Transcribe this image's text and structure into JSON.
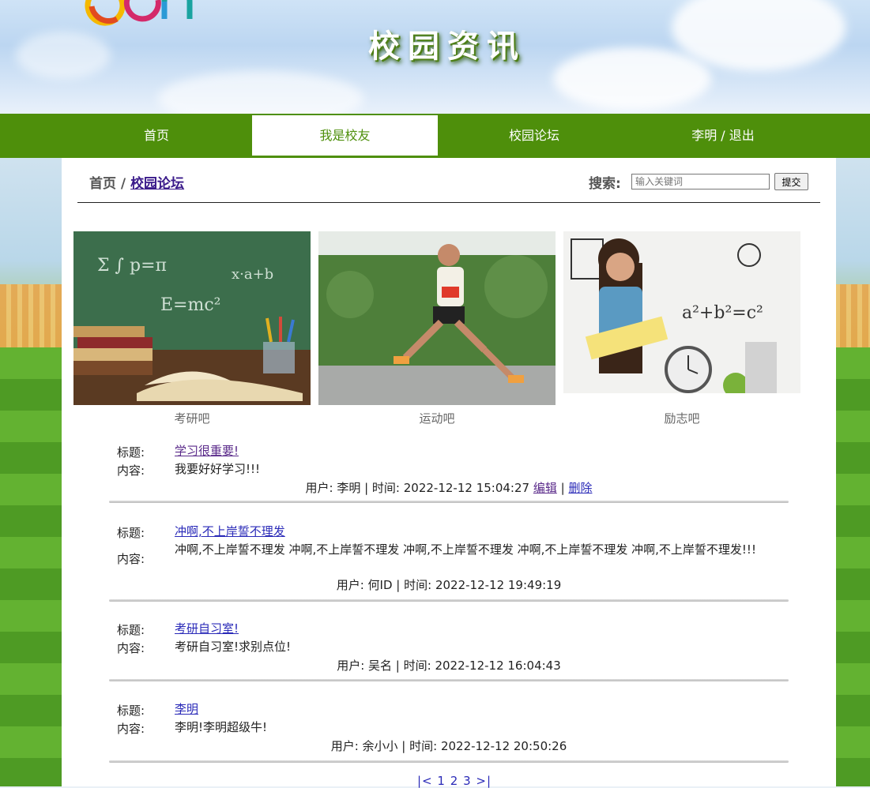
{
  "header": {
    "site_title": "校园资讯"
  },
  "nav": {
    "items": [
      "首页",
      "我是校友",
      "校园论坛",
      "李明 / 退出"
    ],
    "active_index": 1
  },
  "breadcrumb": {
    "home": "首页",
    "separator": "/",
    "current": "校园论坛"
  },
  "search": {
    "label": "搜索:",
    "placeholder": "输入关键词",
    "button": "提交"
  },
  "categories": [
    {
      "caption": "考研吧"
    },
    {
      "caption": "运动吧"
    },
    {
      "caption": "励志吧"
    }
  ],
  "labels": {
    "title": "标题:",
    "content": "内容:"
  },
  "posts": [
    {
      "title": "学习很重要!",
      "content": "我要好好学习!!!",
      "meta": "用户: 李明 | 时间: 2022-12-12 15:04:27",
      "edit": "编辑",
      "delete": "删除"
    },
    {
      "title": "冲啊,不上岸誓不理发",
      "content": "冲啊,不上岸誓不理发 冲啊,不上岸誓不理发 冲啊,不上岸誓不理发 冲啊,不上岸誓不理发 冲啊,不上岸誓不理发!!!",
      "meta": "用户: 何ID | 时间: 2022-12-12 19:49:19"
    },
    {
      "title": "考研自习室!",
      "content": "考研自习室!求别点位!",
      "meta": "用户: 吴名 | 时间: 2022-12-12 16:04:43"
    },
    {
      "title": "李明",
      "content": "李明!李明超级牛!",
      "meta": "用户: 余小小 | 时间: 2022-12-12 20:50:26"
    }
  ],
  "pagination": {
    "first": "|<",
    "pages": [
      "1",
      "2",
      "3"
    ],
    "last": ">|"
  },
  "colors": {
    "nav_green": "#4e8f0b",
    "link_blue": "#2a2ab8"
  },
  "icons": {
    "logo": "colorful-logo-icon"
  }
}
